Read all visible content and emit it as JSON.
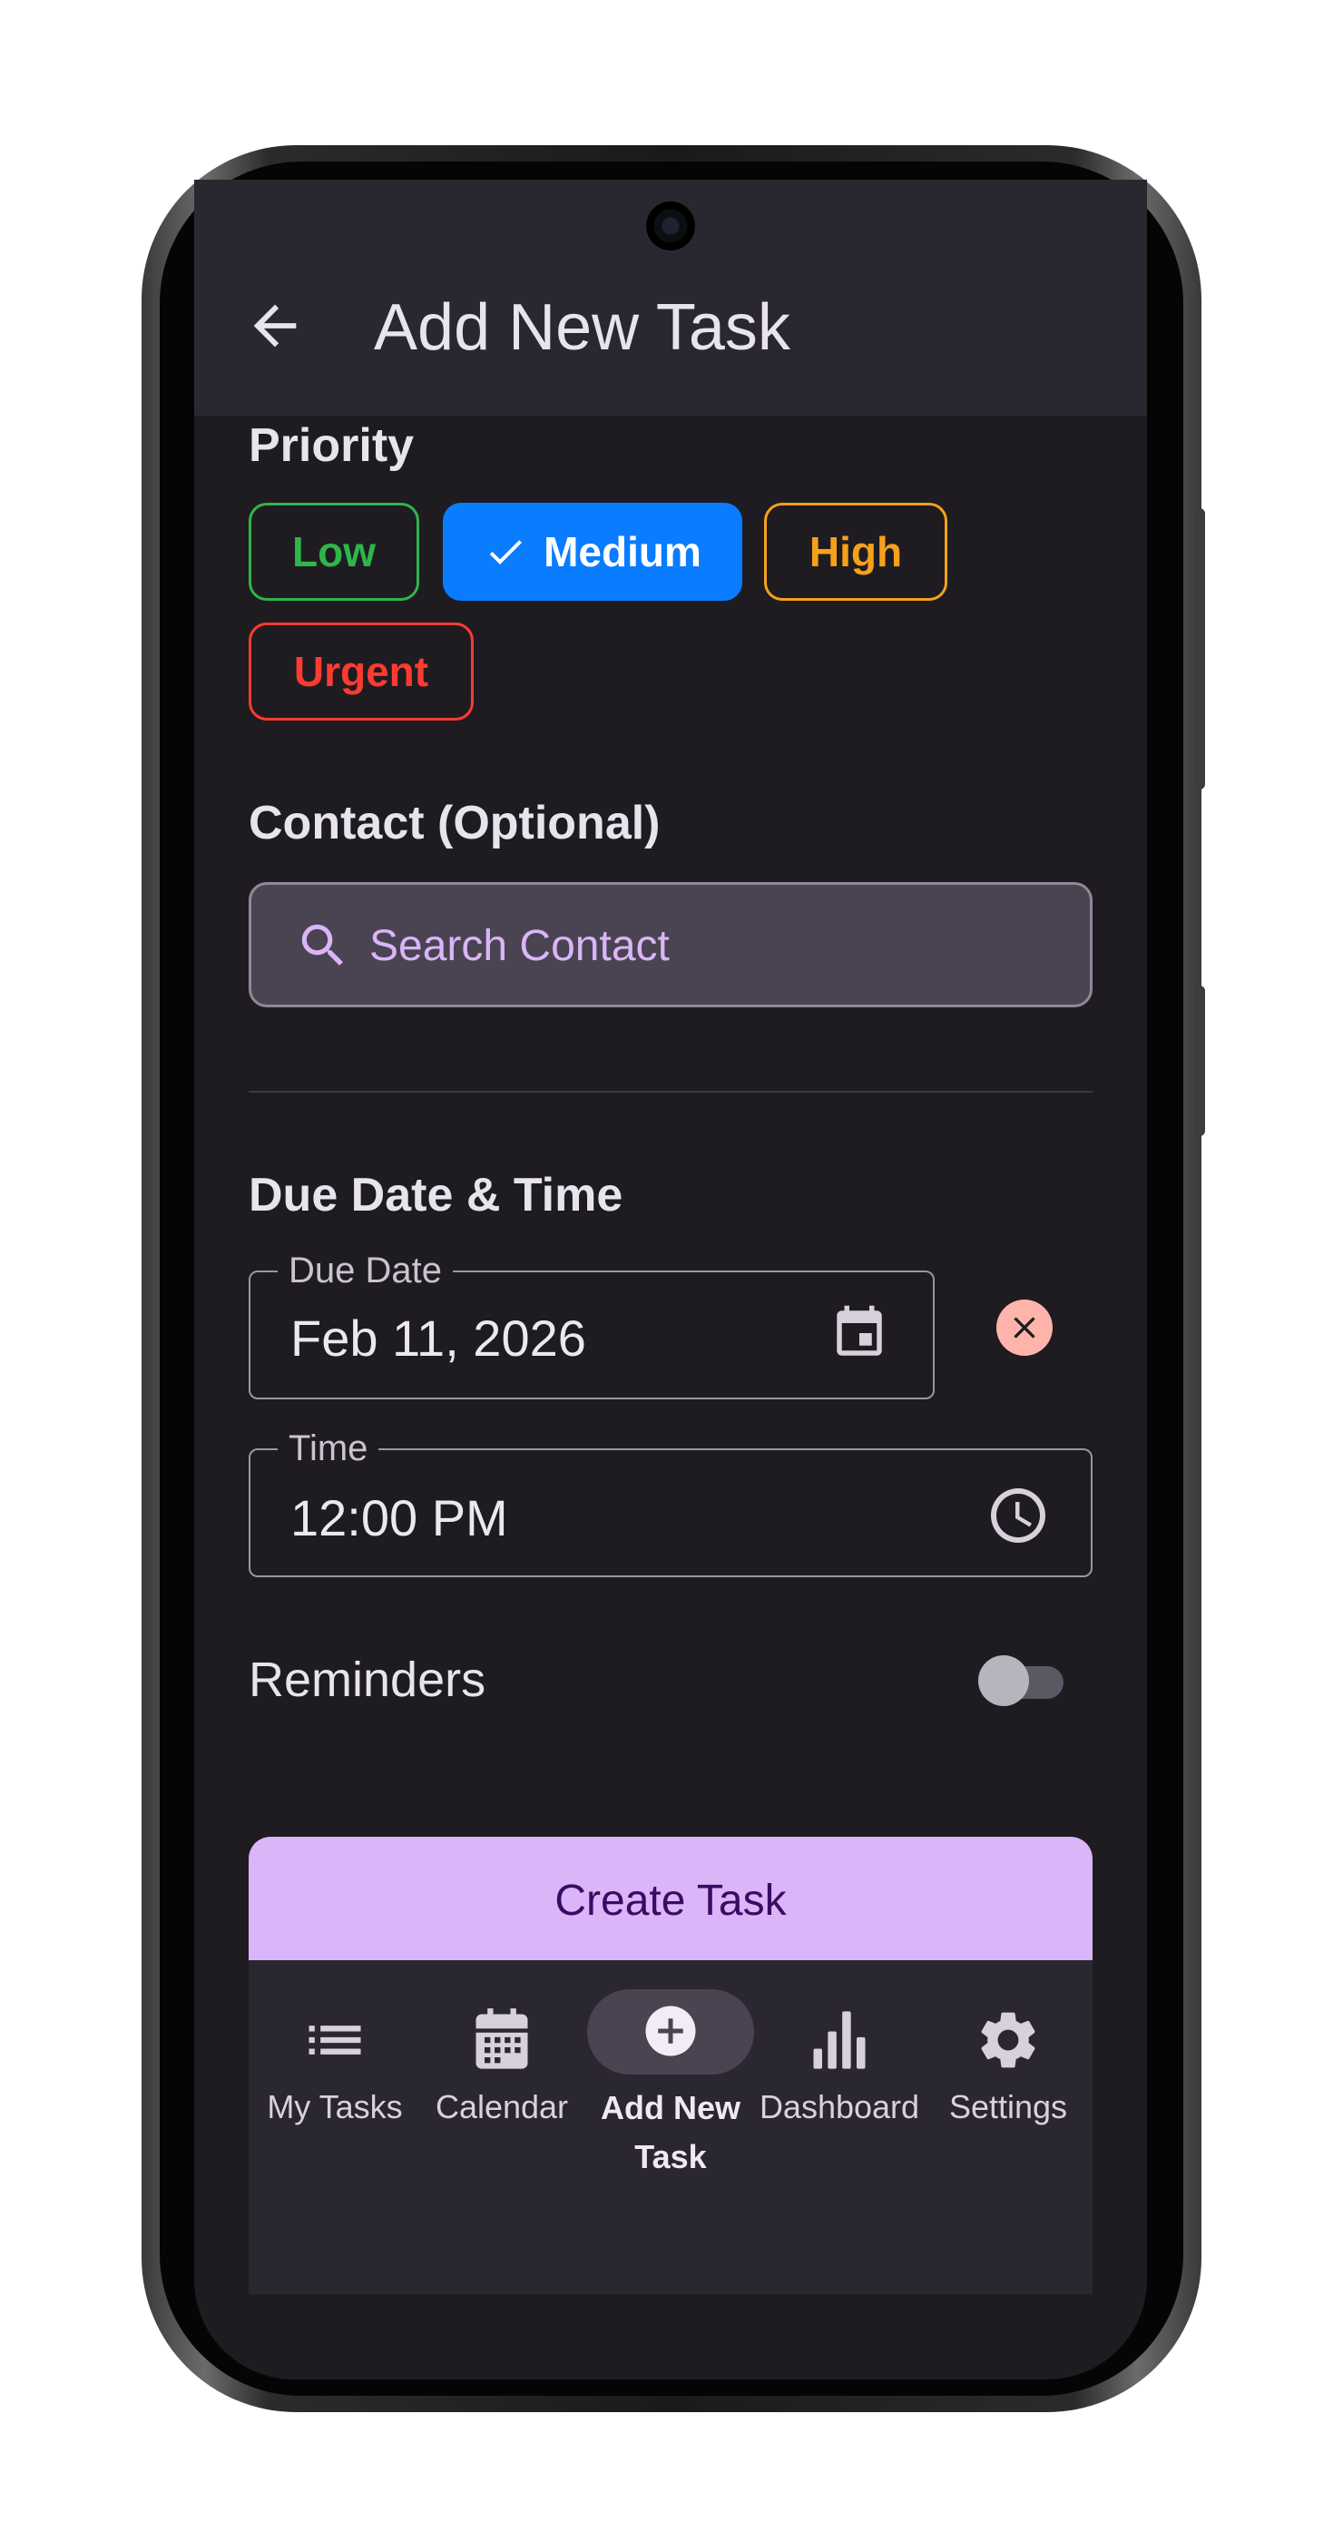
{
  "header": {
    "title": "Add New Task"
  },
  "priority": {
    "title": "Priority",
    "options": [
      {
        "label": "Low",
        "color": "#2fb54a",
        "selected": false
      },
      {
        "label": "Medium",
        "color": "#0a7cff",
        "selected": true
      },
      {
        "label": "High",
        "color": "#f5a11a",
        "selected": false
      },
      {
        "label": "Urgent",
        "color": "#ff3b30",
        "selected": false
      }
    ]
  },
  "contact": {
    "title": "Contact (Optional)",
    "placeholder": "Search Contact"
  },
  "due": {
    "title": "Due Date & Time",
    "date_label": "Due Date",
    "date_value": "Feb 11, 2026",
    "time_label": "Time",
    "time_value": "12:00 PM"
  },
  "reminders": {
    "label": "Reminders",
    "enabled": false
  },
  "create_button": {
    "label": "Create Task"
  },
  "bottom_nav": [
    {
      "label": "My Tasks",
      "icon": "list-icon",
      "active": false
    },
    {
      "label": "Calendar",
      "icon": "calendar-icon",
      "active": false
    },
    {
      "label": "Add New Task",
      "icon": "add-circle-icon",
      "active": true
    },
    {
      "label": "Dashboard",
      "icon": "bar-chart-icon",
      "active": false
    },
    {
      "label": "Settings",
      "icon": "gear-icon",
      "active": false
    }
  ],
  "colors": {
    "background": "#1e1c21",
    "surface": "#2a2731",
    "accent": "#dab5f8",
    "accent_text": "#3b0a63"
  }
}
